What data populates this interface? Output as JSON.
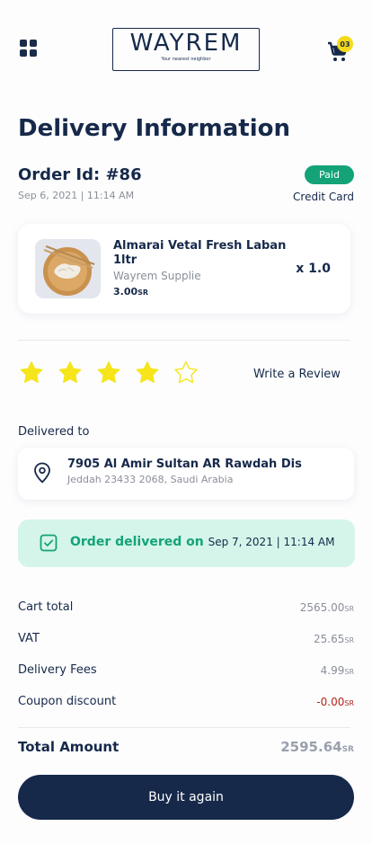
{
  "header": {
    "brand": "WAYREM",
    "tagline": "Your nearest neighbor",
    "cart_count": "03"
  },
  "page": {
    "title": "Delivery Information"
  },
  "order": {
    "id_label": "Order Id: #86",
    "date": "Sep 6, 2021 | 11:14 AM",
    "status": "Paid",
    "payment_method": "Credit Card"
  },
  "product": {
    "name": "Almarai Vetal Fresh Laban 1ltr",
    "vendor": "Wayrem Supplie",
    "price": "3.00",
    "currency": "SR",
    "quantity": "x 1.0"
  },
  "rating": {
    "value": 4,
    "max": 5,
    "review_label": "Write a Review"
  },
  "delivery": {
    "label": "Delivered to",
    "address_line1": "7905 Al Amir Sultan AR Rawdah Dis",
    "address_line2": "Jeddah 23433 2068, Saudi Arabia",
    "status_text": "Order delivered on",
    "status_date": "Sep 7, 2021 | 11:14 AM"
  },
  "summary": {
    "rows": [
      {
        "label": "Cart total",
        "value": "2565.00",
        "currency": "SR"
      },
      {
        "label": "VAT",
        "value": "25.65",
        "currency": "SR"
      },
      {
        "label": "Delivery Fees",
        "value": "4.99",
        "currency": "SR"
      },
      {
        "label": "Coupon discount",
        "value": "-0.00",
        "currency": "SR"
      }
    ],
    "total_label": "Total Amount",
    "total_value": "2595.64",
    "total_currency": "SR"
  },
  "actions": {
    "buy_again": "Buy it again"
  },
  "colors": {
    "navy": "#16294a",
    "accent_green": "#14a378",
    "banner_green": "#d5f5ea",
    "star_yellow": "#f5e51a",
    "discount_red": "#b42318"
  }
}
